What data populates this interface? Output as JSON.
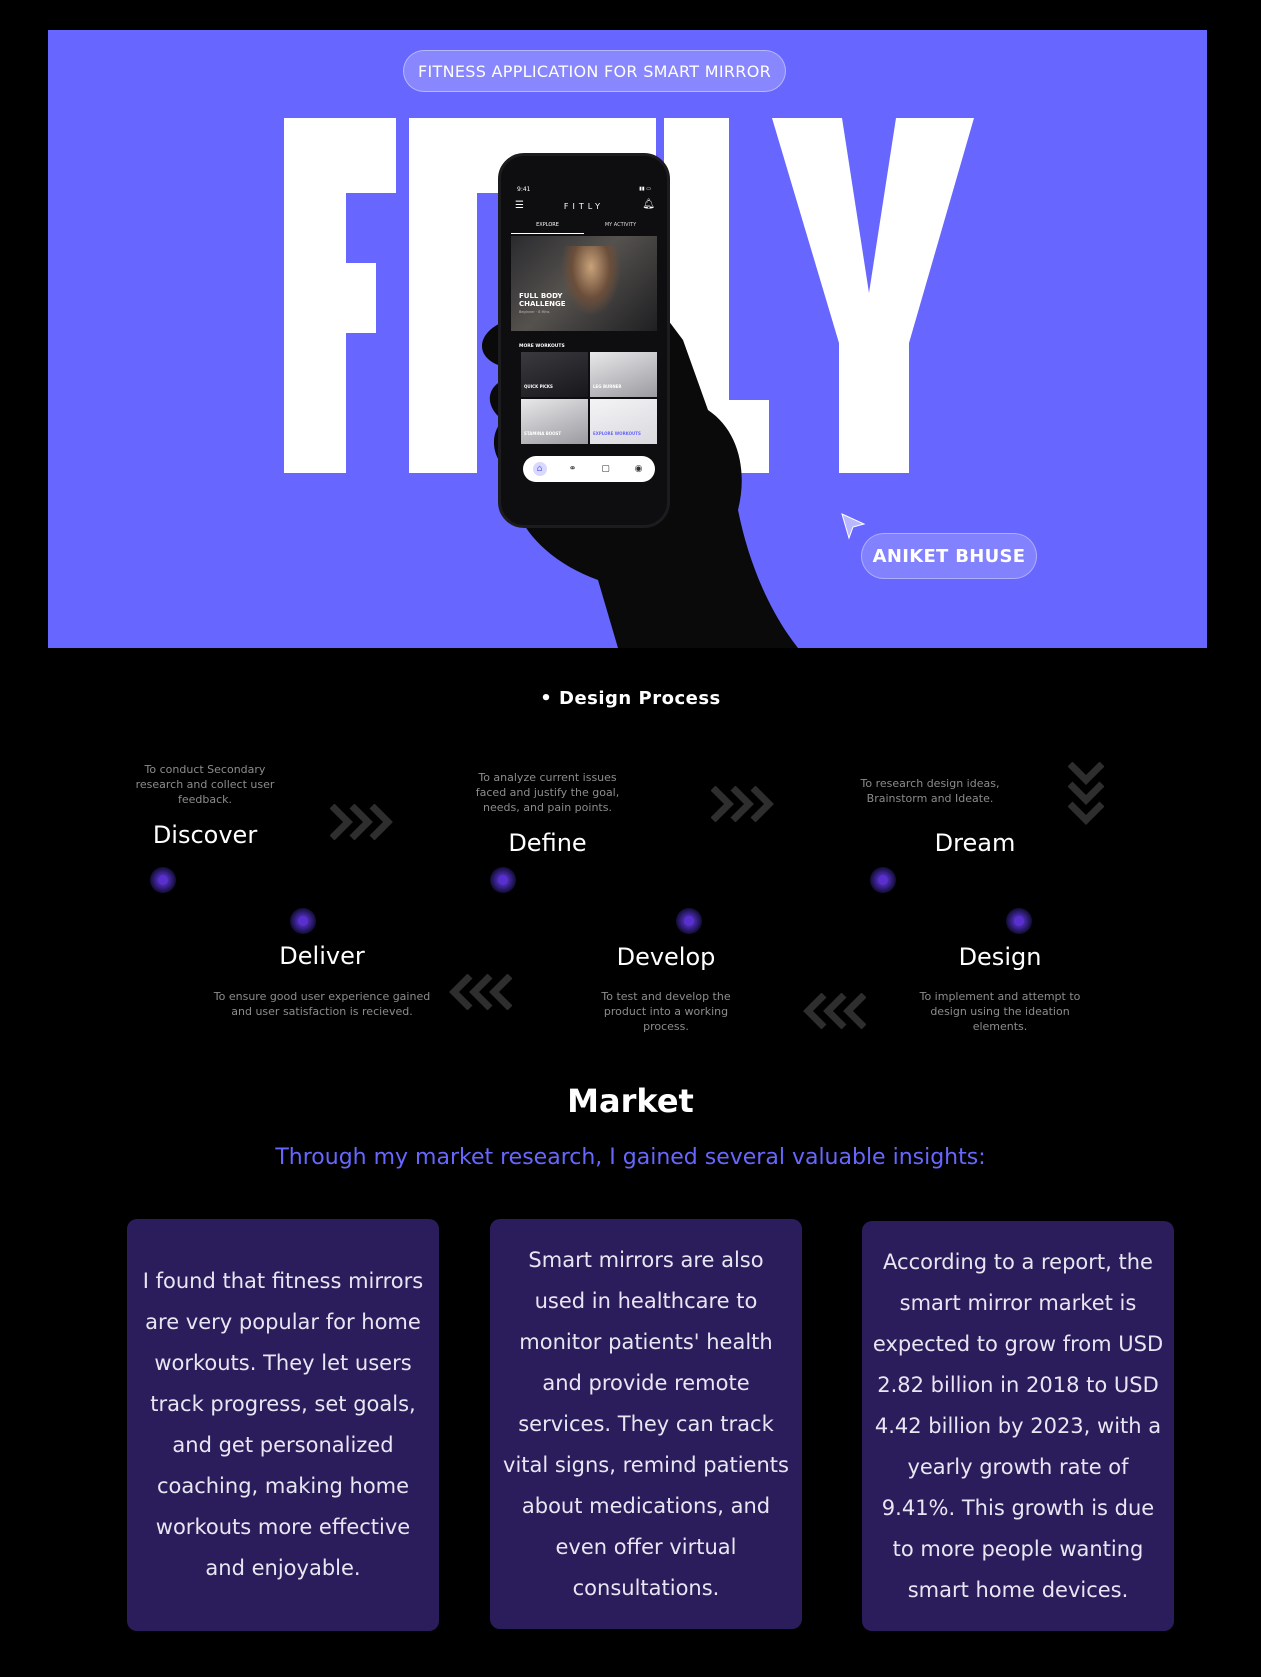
{
  "hero": {
    "tag": "FITNESS APPLICATION FOR SMART MIRROR",
    "title": "FITLY",
    "author": "ANIKET BHUSE",
    "colors": {
      "accent": "#6766fe",
      "background": "#000000"
    },
    "phone": {
      "time": "9:41",
      "logo": "FITLY",
      "tabs": [
        "EXPLORE",
        "MY ACTIVITY"
      ],
      "featured_title": "FULL BODY CHALLENGE",
      "featured_sub": "Beginner · 8 Mins",
      "section_title": "MORE WORKOUTS",
      "cards": [
        "QUICK PICKS",
        "LEG BURNER",
        "STAMINA BOOST",
        "EXPLORE WORKOUTS"
      ],
      "nav_icons": [
        "home-icon",
        "dumbbell-icon",
        "calendar-icon",
        "profile-icon"
      ]
    }
  },
  "process": {
    "heading": "Design Process",
    "steps": [
      {
        "title": "Discover",
        "desc": "To conduct Secondary research and collect user feedback."
      },
      {
        "title": "Define",
        "desc": "To analyze current issues faced and justify the goal, needs, and pain points."
      },
      {
        "title": "Dream",
        "desc": "To research design ideas, Brainstorm and Ideate."
      },
      {
        "title": "Design",
        "desc": "To implement and attempt to design using the ideation elements."
      },
      {
        "title": "Develop",
        "desc": "To test and develop the product into a working process."
      },
      {
        "title": "Deliver",
        "desc": "To ensure good user experience gained and user satisfaction is recieved."
      }
    ]
  },
  "market": {
    "title": "Market",
    "subtitle": "Through my market research, I gained several valuable insights:",
    "cards": [
      "I found that fitness mirrors are very popular for home workouts. They let users track progress, set goals, and get personalized coaching, making home workouts more effective and enjoyable.",
      "Smart mirrors are also used in healthcare to monitor patients' health and provide remote services. They can track vital signs, remind patients about medications, and even offer virtual consultations.",
      "According to a report, the smart mirror market is expected to grow from USD 2.82 billion in 2018 to USD 4.42 billion by 2023, with a yearly growth rate of 9.41%. This growth is due to more people wanting smart home devices."
    ]
  }
}
